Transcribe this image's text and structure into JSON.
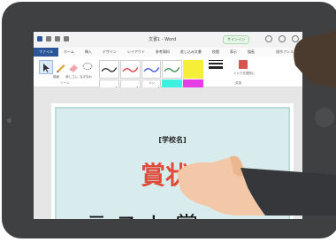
{
  "app": {
    "doc_title": "文書1 - Word",
    "signin_label": "サインイン"
  },
  "tabs": [
    {
      "label": "ファイル",
      "active": true
    },
    {
      "label": "ホーム"
    },
    {
      "label": "挿入"
    },
    {
      "label": "デザイン"
    },
    {
      "label": "レイアウト"
    },
    {
      "label": "参考資料"
    },
    {
      "label": "差し込み文書"
    },
    {
      "label": "校閲"
    },
    {
      "label": "表示"
    },
    {
      "label": "描画"
    }
  ],
  "tab_search": "操作アシスト",
  "ribbon": {
    "tool_labels": [
      "描画",
      "消しゴム",
      "なげなわ"
    ],
    "group_tools": "ツール",
    "group_pens": "ペン",
    "group_convert": "変換",
    "convert_label": "インクを図形に"
  },
  "document": {
    "school_name": "[学校名]",
    "title": "賞状",
    "line2": "テスト賞"
  },
  "colors": {
    "word_blue": "#2b579a",
    "certificate_bg": "#d9eced",
    "title_red": "#e04a3b",
    "tablet_frame": "#3e4042"
  }
}
